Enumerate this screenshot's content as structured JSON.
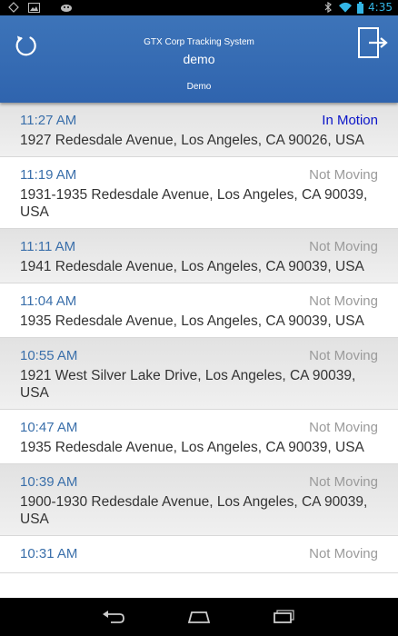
{
  "status_bar": {
    "time": "4:35",
    "icons": [
      "usb-debug-icon",
      "image-icon",
      "android-icon",
      "bluetooth-icon",
      "wifi-icon",
      "battery-icon"
    ]
  },
  "header": {
    "app_title": "GTX Corp Tracking System",
    "user": "demo",
    "org": "Demo",
    "colors": {
      "bar": "#2f64ae"
    }
  },
  "list": {
    "items": [
      {
        "time": "11:27 AM",
        "status": "In Motion",
        "address": "1927 Redesdale Avenue, Los Angeles, CA 90026, USA"
      },
      {
        "time": "11:19 AM",
        "status": "Not Moving",
        "address": "1931-1935 Redesdale Avenue, Los Angeles, CA 90039, USA"
      },
      {
        "time": "11:11 AM",
        "status": "Not Moving",
        "address": "1941 Redesdale Avenue, Los Angeles, CA 90039, USA"
      },
      {
        "time": "11:04 AM",
        "status": "Not Moving",
        "address": "1935 Redesdale Avenue, Los Angeles, CA 90039, USA"
      },
      {
        "time": "10:55 AM",
        "status": "Not Moving",
        "address": "1921 West Silver Lake Drive, Los Angeles, CA 90039, USA"
      },
      {
        "time": "10:47 AM",
        "status": "Not Moving",
        "address": "1935 Redesdale Avenue, Los Angeles, CA 90039, USA"
      },
      {
        "time": "10:39 AM",
        "status": "Not Moving",
        "address": "1900-1930 Redesdale Avenue, Los Angeles, CA 90039, USA"
      },
      {
        "time": "10:31 AM",
        "status": "Not Moving",
        "address": ""
      }
    ],
    "colors": {
      "time": "#3a6faa",
      "in_motion": "#0a14c8",
      "not_moving": "#9a9a9a"
    }
  },
  "nav": {
    "buttons": [
      "back-icon",
      "home-icon",
      "recent-apps-icon"
    ]
  }
}
